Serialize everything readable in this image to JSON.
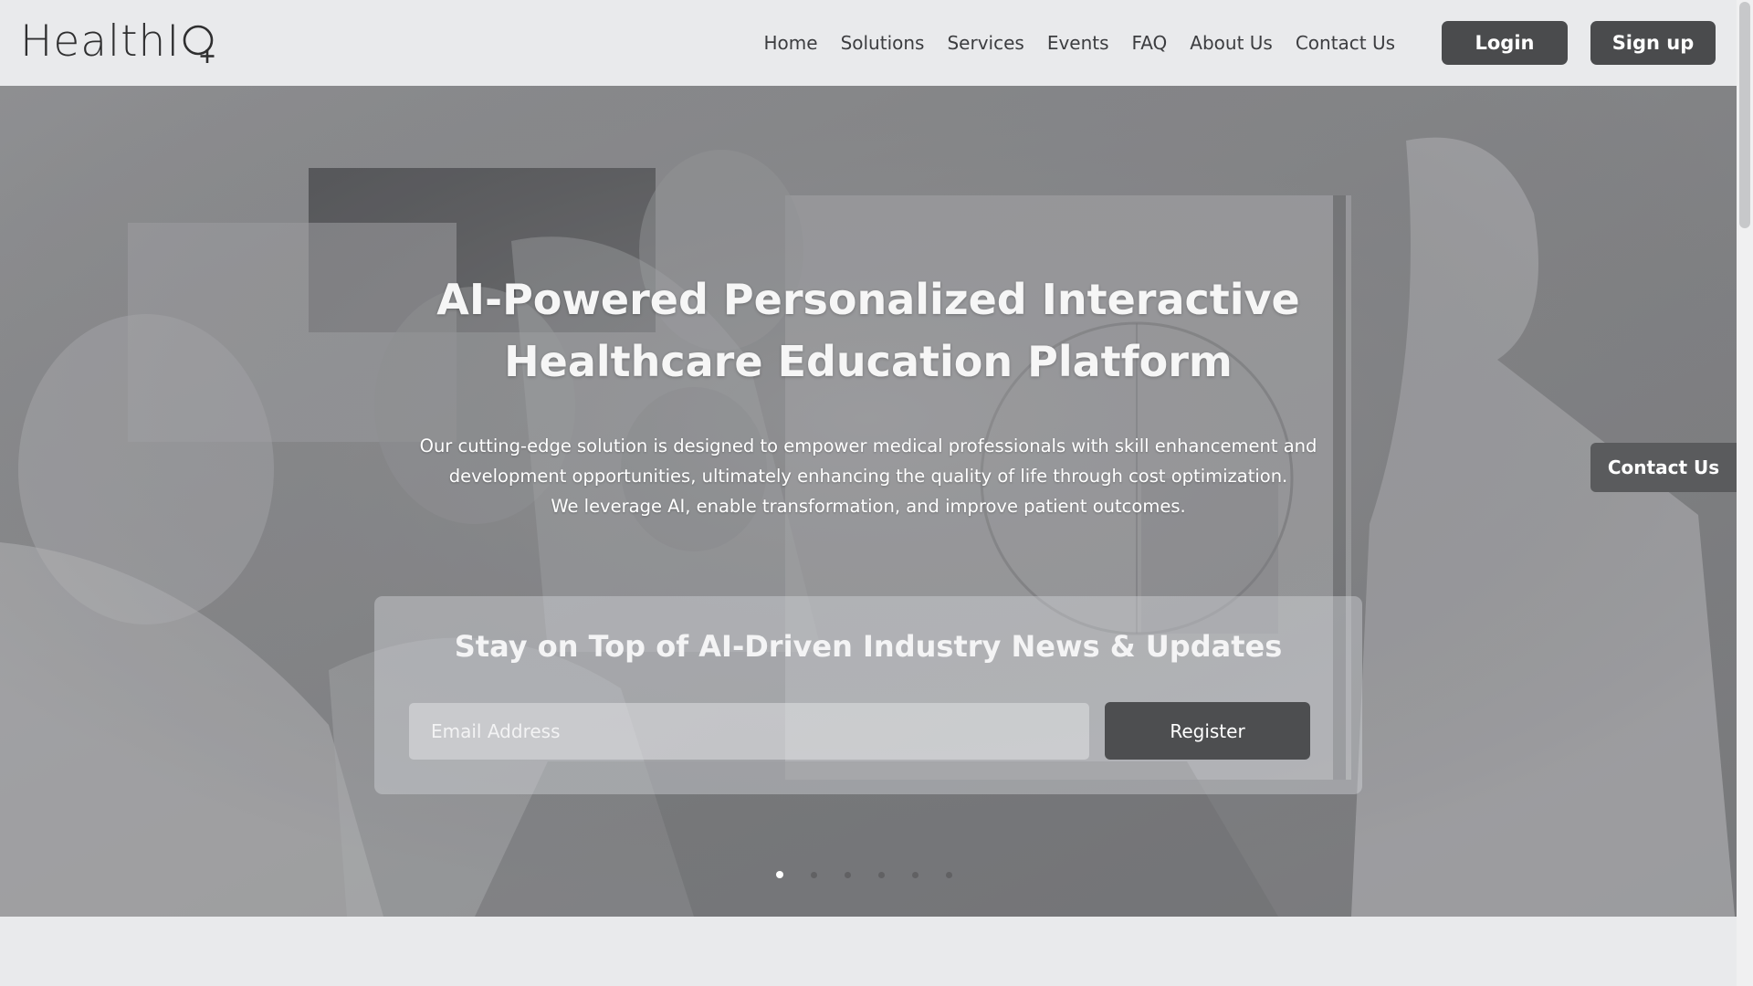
{
  "brand": {
    "logo_text": "HealthIQ",
    "logo_prefix": "HealthI",
    "logo_mark_icon": "q-with-plus-icon"
  },
  "nav": {
    "items": [
      {
        "label": "Home"
      },
      {
        "label": "Solutions"
      },
      {
        "label": "Services"
      },
      {
        "label": "Events"
      },
      {
        "label": "FAQ"
      },
      {
        "label": "About Us"
      },
      {
        "label": "Contact Us"
      }
    ],
    "login_label": "Login",
    "signup_label": "Sign up"
  },
  "hero": {
    "title": "AI-Powered Personalized Interactive Healthcare Education Platform",
    "description_lines": [
      "Our cutting-edge solution is designed to empower medical professionals with skill enhancement and",
      "development opportunities, ultimately enhancing the quality of life through cost optimization.",
      "We leverage AI, enable transformation, and improve patient outcomes."
    ],
    "background_image": "grayscale-photo-doctors-meeting-whiteboard",
    "carousel": {
      "slides": 6,
      "active_index": 0
    }
  },
  "newsletter": {
    "title": "Stay on Top of AI-Driven Industry News & Updates",
    "email_placeholder": "Email Address",
    "email_value": "",
    "register_label": "Register"
  },
  "floating_contact": {
    "label": "Contact Us"
  },
  "colors": {
    "header_bg": "#e9eaec",
    "button_dark": "#4a4b4d",
    "text_dark": "#3c3d40",
    "hero_text": "#ffffff"
  }
}
